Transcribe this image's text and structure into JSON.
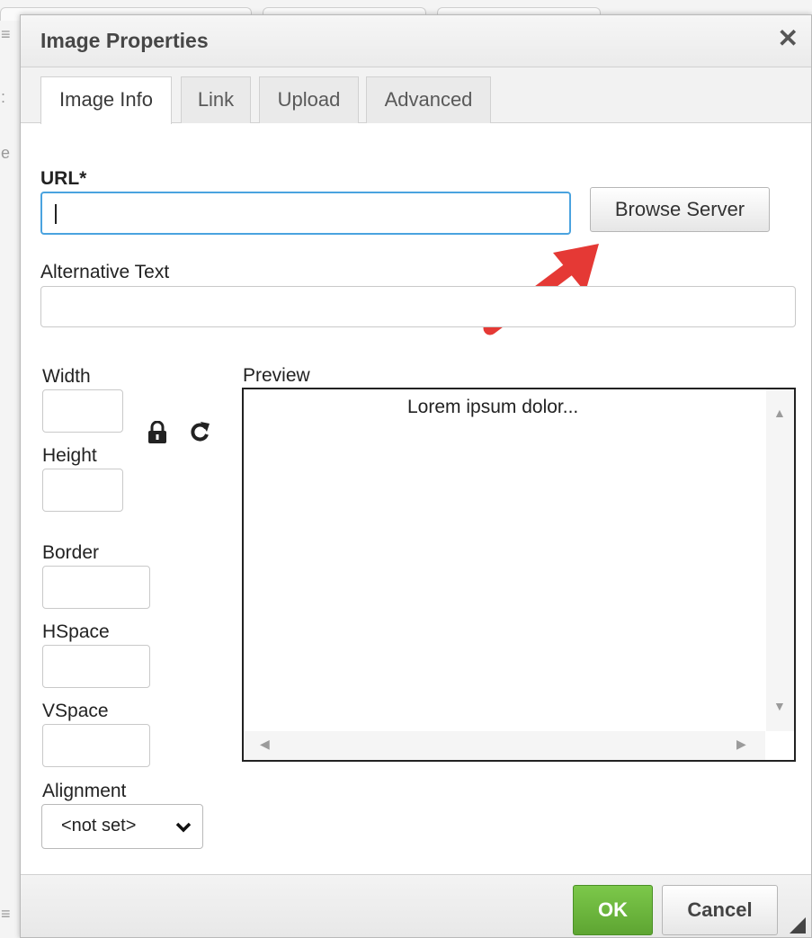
{
  "dialog": {
    "title": "Image Properties",
    "close_icon": "close-icon"
  },
  "tabs": [
    {
      "label": "Image Info",
      "active": true
    },
    {
      "label": "Link",
      "active": false
    },
    {
      "label": "Upload",
      "active": false
    },
    {
      "label": "Advanced",
      "active": false
    }
  ],
  "form": {
    "url_label": "URL*",
    "url_value": "",
    "browse_button": "Browse Server",
    "alt_label": "Alternative Text",
    "alt_value": "",
    "width_label": "Width",
    "width_value": "",
    "height_label": "Height",
    "height_value": "",
    "lock_icon": "lock-icon",
    "reset_icon": "reset-size-icon",
    "border_label": "Border",
    "border_value": "",
    "hspace_label": "HSpace",
    "hspace_value": "",
    "vspace_label": "VSpace",
    "vspace_value": "",
    "alignment_label": "Alignment",
    "alignment_value": "<not set>"
  },
  "preview": {
    "label": "Preview",
    "text": "Lorem ipsum dolor..."
  },
  "footer": {
    "ok_label": "OK",
    "cancel_label": "Cancel"
  },
  "annotation": {
    "arrow_color": "#e53935"
  },
  "colors": {
    "ok_green": "#6cb33f",
    "focus_blue": "#4aa3df"
  }
}
